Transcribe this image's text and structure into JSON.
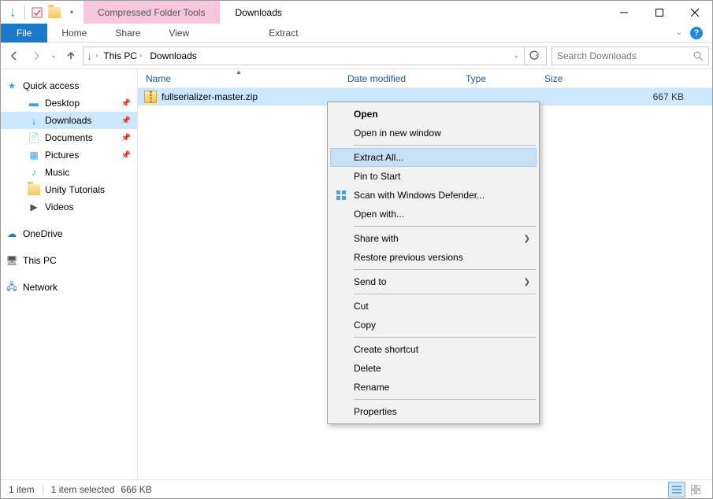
{
  "window": {
    "title": "Downloads",
    "context_tools": "Compressed Folder Tools"
  },
  "ribbon": {
    "file": "File",
    "tabs": [
      "Home",
      "Share",
      "View"
    ],
    "context_tab": "Extract"
  },
  "address": {
    "crumb1": "This PC",
    "crumb2": "Downloads"
  },
  "search": {
    "placeholder": "Search Downloads"
  },
  "sidebar": {
    "quick_access": "Quick access",
    "desktop": "Desktop",
    "downloads": "Downloads",
    "documents": "Documents",
    "pictures": "Pictures",
    "music": "Music",
    "unity": "Unity Tutorials",
    "videos": "Videos",
    "onedrive": "OneDrive",
    "thispc": "This PC",
    "network": "Network"
  },
  "columns": {
    "name": "Name",
    "date": "Date modified",
    "type": "Type",
    "size": "Size"
  },
  "file": {
    "name": "fullserializer-master.zip",
    "size": "667 KB"
  },
  "contextmenu": {
    "open": "Open",
    "open_new": "Open in new window",
    "extract_all": "Extract All...",
    "pin_start": "Pin to Start",
    "scan": "Scan with Windows Defender...",
    "open_with": "Open with...",
    "share_with": "Share with",
    "restore": "Restore previous versions",
    "send_to": "Send to",
    "cut": "Cut",
    "copy": "Copy",
    "shortcut": "Create shortcut",
    "delete": "Delete",
    "rename": "Rename",
    "properties": "Properties"
  },
  "status": {
    "items": "1 item",
    "selected": "1 item selected",
    "size": "666 KB"
  }
}
